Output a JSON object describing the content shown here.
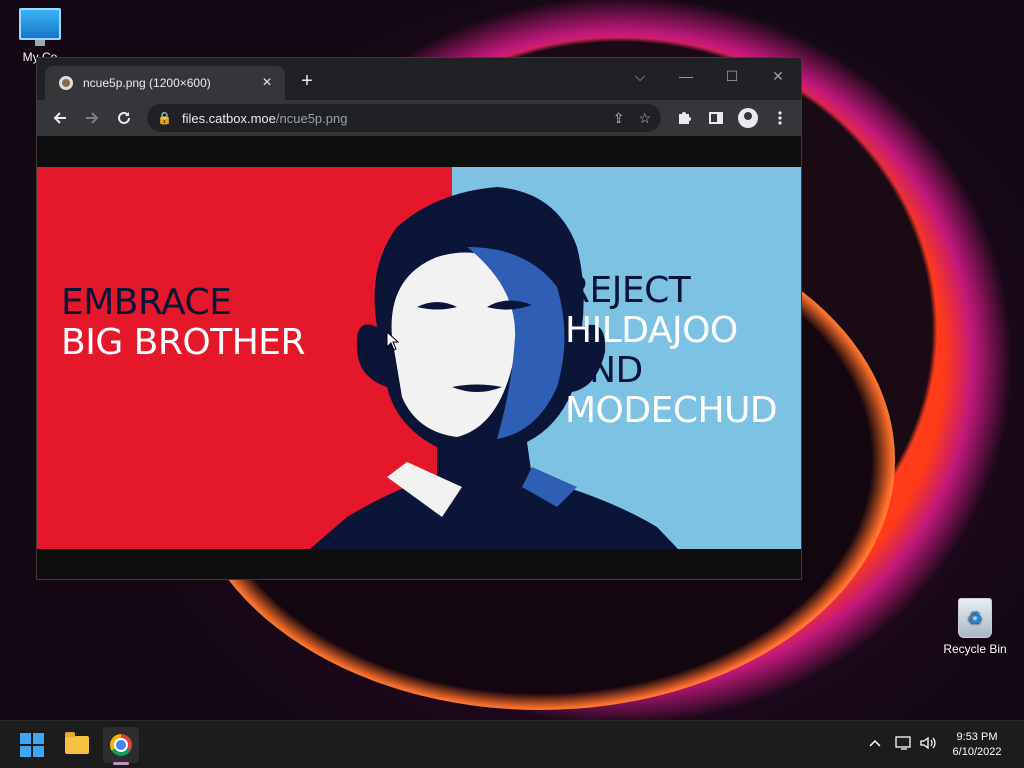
{
  "desktop": {
    "icons": [
      {
        "label": "My Co"
      },
      {
        "label": "Recycle Bin"
      }
    ]
  },
  "browser": {
    "tab": {
      "title": "ncue5p.png (1200×600)",
      "close_icon": "close-icon"
    },
    "new_tab_label": "+",
    "window_controls": {
      "dropdown": "⌵",
      "minimize": "—",
      "maximize": "☐",
      "close": "✕"
    },
    "omnibox": {
      "host": "files.catbox.moe",
      "path": "/ncue5p.png"
    }
  },
  "image": {
    "left_text": [
      "EMBRACE",
      "BIG BROTHER"
    ],
    "right_text": [
      "REJECT",
      "HILDAJOO",
      "AND",
      "MODECHUD"
    ],
    "colors": {
      "left_bg": "#e5172b",
      "right_bg": "#7ec2e3",
      "dark_ink": "#0b1538"
    }
  },
  "taskbar": {
    "clock": {
      "time": "9:53 PM",
      "date": "6/10/2022"
    },
    "tray_icons": [
      "chevron-up-icon",
      "network-icon",
      "volume-icon"
    ]
  }
}
